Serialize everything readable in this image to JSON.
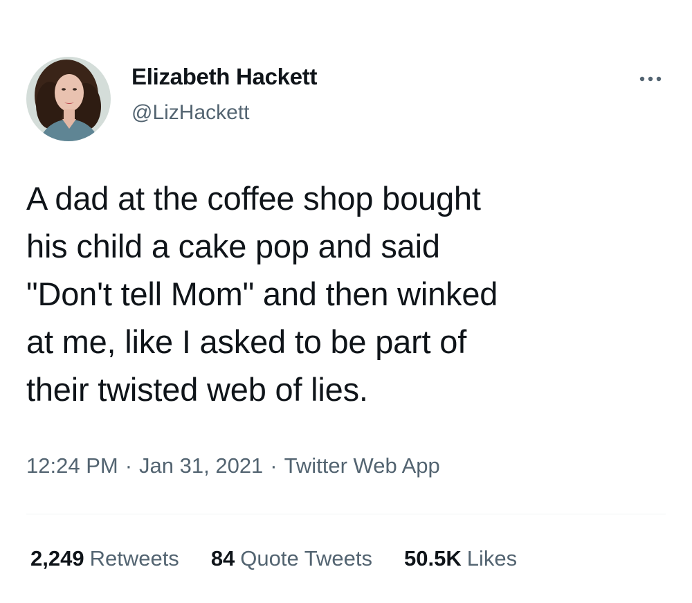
{
  "author": {
    "display_name": "Elizabeth Hackett",
    "handle": "@LizHackett",
    "avatar_icon": "profile-photo"
  },
  "more_icon": "more-horizontal-icon",
  "tweet": {
    "text": "A dad at the coffee shop bought\nhis child a cake pop and said\n\"Don't tell Mom\" and then winked\nat me, like I asked to be part of\ntheir twisted web of lies."
  },
  "meta": {
    "time": "12:24 PM",
    "separator": "·",
    "date": "Jan 31, 2021",
    "source": "Twitter Web App"
  },
  "stats": {
    "retweets": {
      "count": "2,249",
      "label": "Retweets"
    },
    "quote_tweets": {
      "count": "84",
      "label": "Quote Tweets"
    },
    "likes": {
      "count": "50.5K",
      "label": "Likes"
    }
  },
  "colors": {
    "text_primary": "#0f1419",
    "text_secondary": "#536471",
    "divider": "#eff3f4"
  }
}
